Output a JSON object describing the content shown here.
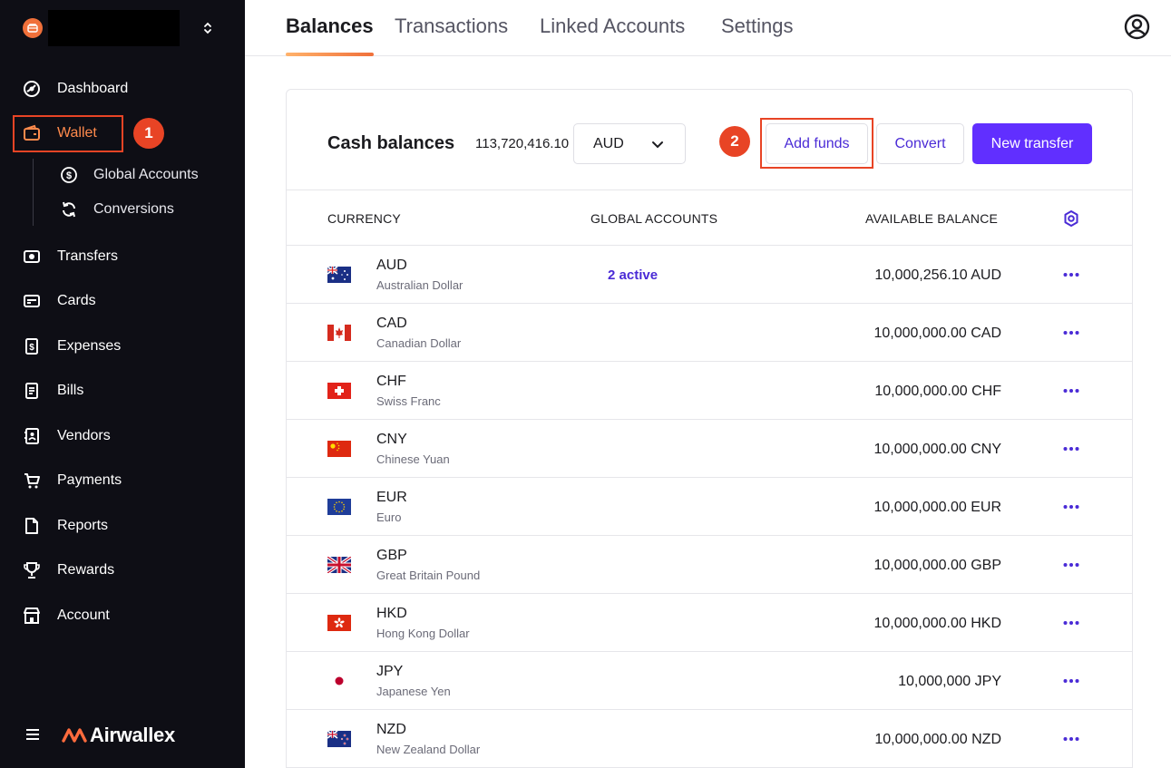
{
  "sidebar": {
    "nav": [
      {
        "label": "Dashboard",
        "icon": "dashboard-icon"
      },
      {
        "label": "Wallet",
        "icon": "wallet-icon",
        "active": true
      },
      {
        "label": "Transfers",
        "icon": "transfers-icon"
      },
      {
        "label": "Cards",
        "icon": "card-icon"
      },
      {
        "label": "Expenses",
        "icon": "expenses-icon"
      },
      {
        "label": "Bills",
        "icon": "bills-icon"
      },
      {
        "label": "Vendors",
        "icon": "vendors-icon"
      },
      {
        "label": "Payments",
        "icon": "cart-icon"
      },
      {
        "label": "Reports",
        "icon": "report-icon"
      },
      {
        "label": "Rewards",
        "icon": "trophy-icon"
      },
      {
        "label": "Account",
        "icon": "store-icon"
      }
    ],
    "wallet_sub": [
      {
        "label": "Global Accounts",
        "icon": "dollar-circle-icon"
      },
      {
        "label": "Conversions",
        "icon": "refresh-icon"
      }
    ],
    "brand": "Airwallex"
  },
  "annotations": {
    "step1": "1",
    "step2": "2"
  },
  "tabs": [
    {
      "label": "Balances",
      "active": true
    },
    {
      "label": "Transactions"
    },
    {
      "label": "Linked Accounts"
    },
    {
      "label": "Settings"
    }
  ],
  "card": {
    "title": "Cash balances",
    "total": "113,720,416.10",
    "currency_select": "AUD",
    "add_funds": "Add funds",
    "convert": "Convert",
    "new_transfer": "New transfer"
  },
  "table": {
    "headers": {
      "currency": "CURRENCY",
      "global_accounts": "GLOBAL ACCOUNTS",
      "available_balance": "AVAILABLE BALANCE"
    },
    "rows": [
      {
        "code": "AUD",
        "name": "Australian Dollar",
        "global_accounts": "2 active",
        "balance": "10,000,256.10 AUD"
      },
      {
        "code": "CAD",
        "name": "Canadian Dollar",
        "global_accounts": "",
        "balance": "10,000,000.00 CAD"
      },
      {
        "code": "CHF",
        "name": "Swiss Franc",
        "global_accounts": "",
        "balance": "10,000,000.00 CHF"
      },
      {
        "code": "CNY",
        "name": "Chinese Yuan",
        "global_accounts": "",
        "balance": "10,000,000.00 CNY"
      },
      {
        "code": "EUR",
        "name": "Euro",
        "global_accounts": "",
        "balance": "10,000,000.00 EUR"
      },
      {
        "code": "GBP",
        "name": "Great Britain Pound",
        "global_accounts": "",
        "balance": "10,000,000.00 GBP"
      },
      {
        "code": "HKD",
        "name": "Hong Kong Dollar",
        "global_accounts": "",
        "balance": "10,000,000.00 HKD"
      },
      {
        "code": "JPY",
        "name": "Japanese Yen",
        "global_accounts": "",
        "balance": "10,000,000 JPY"
      },
      {
        "code": "NZD",
        "name": "New Zealand Dollar",
        "global_accounts": "",
        "balance": "10,000,000.00 NZD"
      }
    ]
  },
  "colors": {
    "accent": "#612fff",
    "link": "#4a2bd6",
    "annotation": "#e84425",
    "sidebar_bg": "#0e0e15",
    "active_nav": "#ff8a4c"
  }
}
